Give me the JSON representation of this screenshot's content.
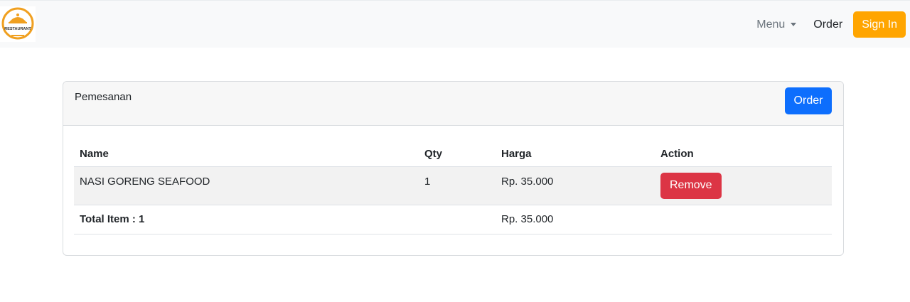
{
  "navbar": {
    "logo_text": "RESTAURANT",
    "menu_label": "Menu",
    "order_label": "Order",
    "signin_label": "Sign In"
  },
  "card": {
    "title": "Pemesanan",
    "order_button": "Order"
  },
  "table": {
    "headers": [
      "Name",
      "Qty",
      "Harga",
      "Action"
    ],
    "rows": [
      {
        "name": "NASI GORENG SEAFOOD",
        "qty": "1",
        "harga": "Rp. 35.000",
        "action": "Remove"
      }
    ],
    "total_label": "Total Item : 1",
    "total_price": "Rp. 35.000"
  },
  "colors": {
    "signin_bg": "#ffa500",
    "order_bg": "#0d6efd",
    "remove_bg": "#dc3545",
    "navbar_bg": "#f8f9fa"
  },
  "icons": {
    "logo": "restaurant-logo-icon",
    "caret": "caret-down-icon"
  }
}
